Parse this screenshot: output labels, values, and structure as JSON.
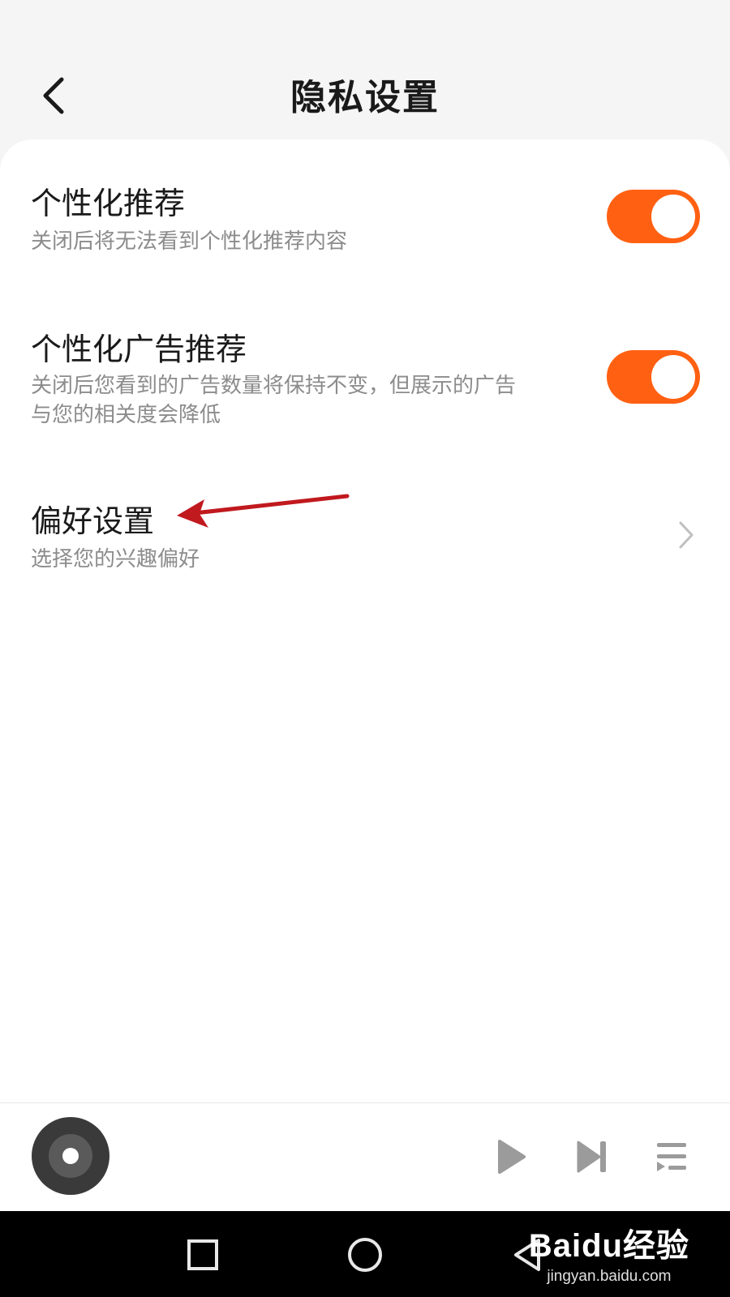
{
  "header": {
    "title": "隐私设置",
    "back_icon": "chevron-left-icon"
  },
  "settings": [
    {
      "title": "个性化推荐",
      "description": "关闭后将无法看到个性化推荐内容",
      "control": "toggle",
      "enabled": true
    },
    {
      "title": "个性化广告推荐",
      "description_lines": [
        "关闭后您看到的广告数量将保持不变，但展示的广告",
        "与您的相关度会降低"
      ],
      "control": "toggle",
      "enabled": true
    },
    {
      "title": "偏好设置",
      "description": "选择您的兴趣偏好",
      "control": "chevron"
    }
  ],
  "annotation": {
    "type": "arrow",
    "color": "#c0191e",
    "points_to": "偏好设置"
  },
  "mini_player": {
    "icons": [
      "disc-icon",
      "play-icon",
      "next-track-icon",
      "playlist-icon"
    ]
  },
  "nav_bar": {
    "icons": [
      "recents-square-icon",
      "home-circle-icon",
      "back-triangle-icon"
    ]
  },
  "watermark": {
    "logo": "Baidu经验",
    "url": "jingyan.baidu.com"
  },
  "colors": {
    "accent": "#ff6012",
    "background": "#f5f5f5",
    "card": "#ffffff",
    "title_text": "#1a1a1a",
    "secondary_text": "#8c8c8c",
    "annotation": "#c0191e"
  }
}
